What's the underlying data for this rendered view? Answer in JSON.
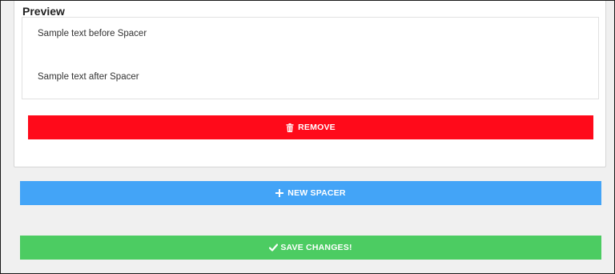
{
  "preview": {
    "title": "Preview",
    "text_before": "Sample text before Spacer",
    "text_after": "Sample text after Spacer",
    "remove_label": "REMOVE",
    "remove_icon": "trash-icon"
  },
  "actions": {
    "new_spacer_label": "NEW SPACER",
    "new_spacer_icon": "plus-icon",
    "save_label": "SAVE CHANGES!",
    "save_icon": "checkmark-icon"
  },
  "colors": {
    "remove": "#ff0a1a",
    "new_spacer": "#43a4f7",
    "save": "#4ccc62"
  }
}
